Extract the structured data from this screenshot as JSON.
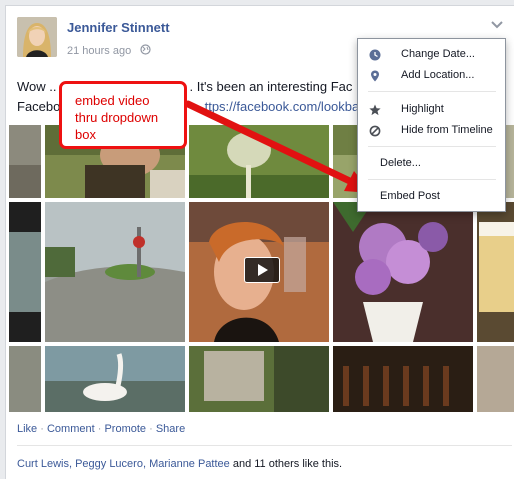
{
  "post": {
    "author": "Jennifer Stinnett",
    "timestamp": "21 hours ago",
    "privacy_icon": "globe-icon",
    "text_line1_start": "Wow ..",
    "text_line1_end": ". It's been an interesting Fac",
    "text_line2_start": "Faceboo",
    "text_line2_link": "ttps://facebook.com/lookba"
  },
  "annotation": {
    "line1": "embed video",
    "line2": "thru dropdown",
    "line3": "box",
    "color": "#e11111"
  },
  "menu": {
    "items": [
      {
        "label": "Change Date...",
        "icon": "clock-icon"
      },
      {
        "label": "Add Location...",
        "icon": "map-pin-icon"
      },
      {
        "label": "Highlight",
        "icon": "star-icon"
      },
      {
        "label": "Hide from Timeline",
        "icon": "hide-icon"
      },
      {
        "label": "Delete...",
        "icon": ""
      },
      {
        "label": "Embed Post",
        "icon": ""
      }
    ]
  },
  "actions": {
    "like": "Like",
    "comment": "Comment",
    "promote": "Promote",
    "share": "Share",
    "separator": "·"
  },
  "likes": {
    "names": "Curt Lewis, Peggy Lucero, Marianne Pattee",
    "rest": " and 11 others like this."
  },
  "colors": {
    "link": "#3b5998",
    "meta": "#9197a3",
    "annotation": "#e11111"
  }
}
